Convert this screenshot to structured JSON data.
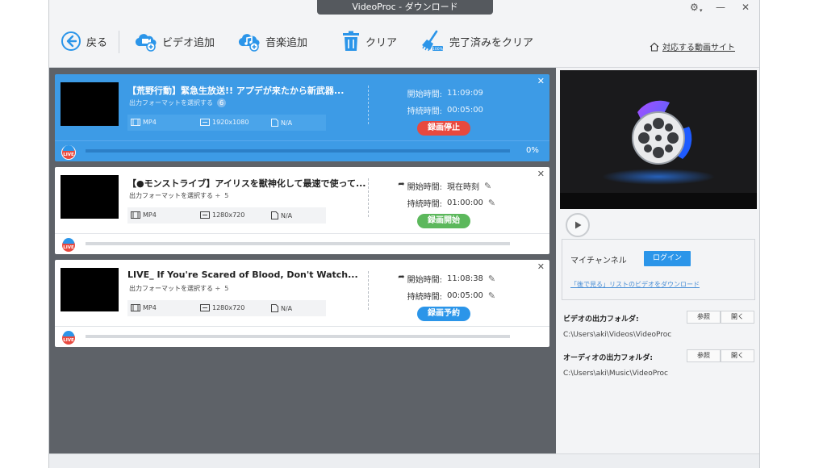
{
  "window": {
    "title": "VideoProc - ダウンロード"
  },
  "toolbar": {
    "back_label": "戻る",
    "add_video_label": "ビデオ追加",
    "add_music_label": "音楽追加",
    "clear_label": "クリア",
    "clear_done_label": "完了済みをクリア",
    "supported_sites_label": "対応する動画サイト"
  },
  "items": [
    {
      "title": "【荒野行動】緊急生放送!! アプデが来たから新武器...",
      "format_select": "出力フォーマットを選択する",
      "format_count": "6",
      "container": "MP4",
      "resolution": "1920x1080",
      "size": "N/A",
      "start_label": "開始時間:",
      "start_value": "11:09:09",
      "duration_label": "持続時間:",
      "duration_value": "00:05:00",
      "button": "録画停止",
      "progress_text": "0%",
      "live_badge": "LIVE"
    },
    {
      "title": "【●モンストライブ】アイリスを獣神化して最速で使って...",
      "format_select": "出力フォーマットを選択する ÷",
      "format_count": "5",
      "container": "MP4",
      "resolution": "1280x720",
      "size": "N/A",
      "start_label": "開始時間:",
      "start_value": "現在時刻",
      "duration_label": "持続時間:",
      "duration_value": "01:00:00",
      "button": "録画開始",
      "live_badge": "LIVE"
    },
    {
      "title": "LIVE_ If You're Scared of Blood, Don't Watch...",
      "format_select": "出力フォーマットを選択する ÷",
      "format_count": "5",
      "container": "MP4",
      "resolution": "1280x720",
      "size": "N/A",
      "start_label": "開始時間:",
      "start_value": "11:08:38",
      "duration_label": "持続時間:",
      "duration_value": "00:05:00",
      "button": "録画予約",
      "live_badge": "LIVE"
    }
  ],
  "right": {
    "channel_label": "マイチャンネル",
    "login_label": "ログイン",
    "watch_later_link": "「後で見る」リストのビデオをダウンロード",
    "video_folder_label": "ビデオの出力フォルダ:",
    "video_folder_path": "C:\\Users\\aki\\Videos\\VideoProc",
    "audio_folder_label": "オーディオの出力フォルダ:",
    "audio_folder_path": "C:\\Users\\aki\\Music\\VideoProc",
    "browse_label": "参照",
    "open_label": "開く"
  },
  "colors": {
    "active_item": "#3d9be6",
    "stop_button": "#e8493f",
    "start_button": "#5cb85c",
    "schedule_button": "#2b95e9",
    "accent": "#2b95e9"
  }
}
